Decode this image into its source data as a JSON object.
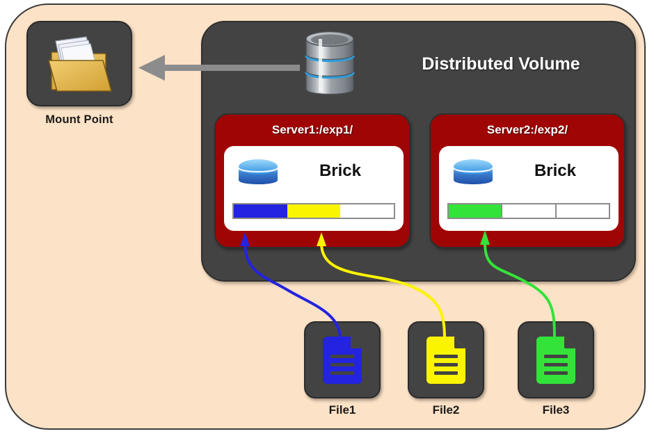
{
  "diagram": {
    "title": "Distributed Volume",
    "background_color": "#FCE2C6",
    "panel_color": "#434343",
    "server_box_color": "#A00505"
  },
  "mount_point": {
    "label": "Mount Point",
    "icon": "open-folder-with-documents-icon"
  },
  "volume": {
    "title": "Distributed Volume",
    "icon": "database-cylinder-icon"
  },
  "servers": [
    {
      "label": "Server1:/exp1/",
      "brick_label": "Brick",
      "brick_icon": "blue-disk-icon",
      "capacity_segments": [
        {
          "name": "File1",
          "color": "#2323E0",
          "filled": true
        },
        {
          "name": "File2",
          "color": "#FBF400",
          "filled": true
        },
        {
          "name": "free",
          "color": "#FFFFFF",
          "filled": false
        }
      ],
      "dividers_visible": false
    },
    {
      "label": "Server2:/exp2/",
      "brick_label": "Brick",
      "brick_icon": "blue-disk-icon",
      "capacity_segments": [
        {
          "name": "File3",
          "color": "#33E33A",
          "filled": true
        },
        {
          "name": "free",
          "color": "#FFFFFF",
          "filled": false
        },
        {
          "name": "free",
          "color": "#FFFFFF",
          "filled": false
        }
      ],
      "dividers_visible": true
    }
  ],
  "files": [
    {
      "label": "File1",
      "color": "#2323E0",
      "icon": "document-file-icon",
      "target_server": "Server1:/exp1/"
    },
    {
      "label": "File2",
      "color": "#FBF400",
      "icon": "document-file-icon",
      "target_server": "Server1:/exp1/"
    },
    {
      "label": "File3",
      "color": "#33E33A",
      "icon": "document-file-icon",
      "target_server": "Server2:/exp2/"
    }
  ],
  "connectors": {
    "mount_arrow": {
      "icon": "left-arrow-icon",
      "color": "#8C8C8C",
      "from": "Distributed Volume",
      "to": "Mount Point"
    },
    "file_arrows": [
      {
        "icon": "curved-arrow-icon",
        "color": "#2323E0",
        "from": "File1",
        "to": "Server1:/exp1/"
      },
      {
        "icon": "curved-arrow-icon",
        "color": "#FBF400",
        "from": "File2",
        "to": "Server1:/exp1/"
      },
      {
        "icon": "curved-arrow-icon",
        "color": "#33E33A",
        "from": "File3",
        "to": "Server2:/exp2/"
      }
    ]
  }
}
